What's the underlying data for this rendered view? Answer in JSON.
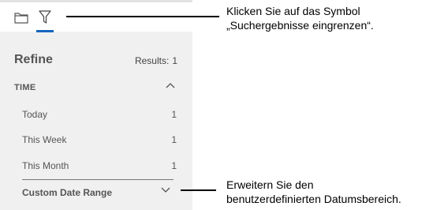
{
  "toolbar": {
    "folder_icon": "folder-icon",
    "filter_icon": "filter-icon",
    "active_color": "#1565c0"
  },
  "refine": {
    "title": "Refine",
    "results_label": "Results:",
    "results_count": "1"
  },
  "time_section": {
    "header": "TIME",
    "items": [
      {
        "label": "Today",
        "count": "1"
      },
      {
        "label": "This Week",
        "count": "1"
      },
      {
        "label": "This Month",
        "count": "1"
      }
    ],
    "custom_label": "Custom Date Range"
  },
  "callouts": {
    "filter_line1": "Klicken Sie auf das Symbol",
    "filter_line2": "„Suchergebnisse eingrenzen“.",
    "custom_line1": "Erweitern Sie den",
    "custom_line2": "benutzerdefinierten Datumsbereich."
  }
}
